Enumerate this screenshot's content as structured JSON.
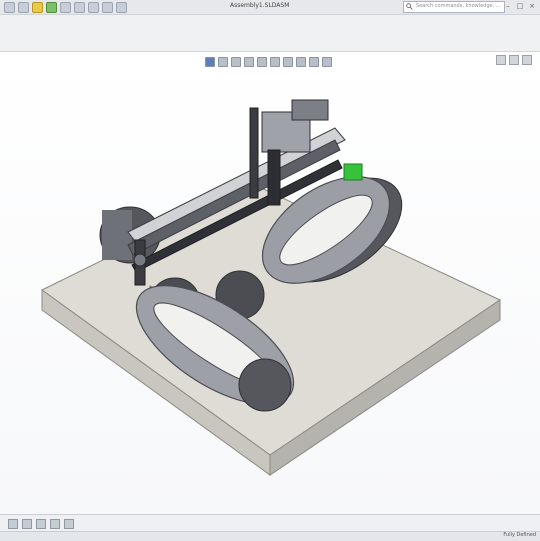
{
  "window": {
    "doc_title": "Assembly1.SLDASM",
    "search_placeholder": "Search commands, knowledge, ...",
    "controls": [
      "minimize",
      "maximize",
      "close"
    ]
  },
  "quick_access": {
    "icons": [
      "home-icon",
      "new-icon",
      "open-icon",
      "save-icon",
      "print-icon",
      "undo-icon",
      "select-icon",
      "rebuild-icon",
      "options-icon"
    ]
  },
  "ribbon": {
    "icons": [
      "ribbon-icon"
    ]
  },
  "heads_up_toolbar": {
    "icons": [
      "zoom-fit-icon",
      "zoom-area-icon",
      "previous-view-icon",
      "section-view-icon",
      "view-orientation-icon",
      "display-style-icon",
      "hide-show-icon",
      "appearance-icon",
      "scene-icon",
      "view-settings-icon"
    ]
  },
  "status": {
    "text": "Fully Defined"
  },
  "colors": {
    "base_plate": "#d8d6ce",
    "guide_dark": "#4b4d52",
    "guide_plate": "#8c8f95",
    "accent_green": "#33cc33"
  }
}
